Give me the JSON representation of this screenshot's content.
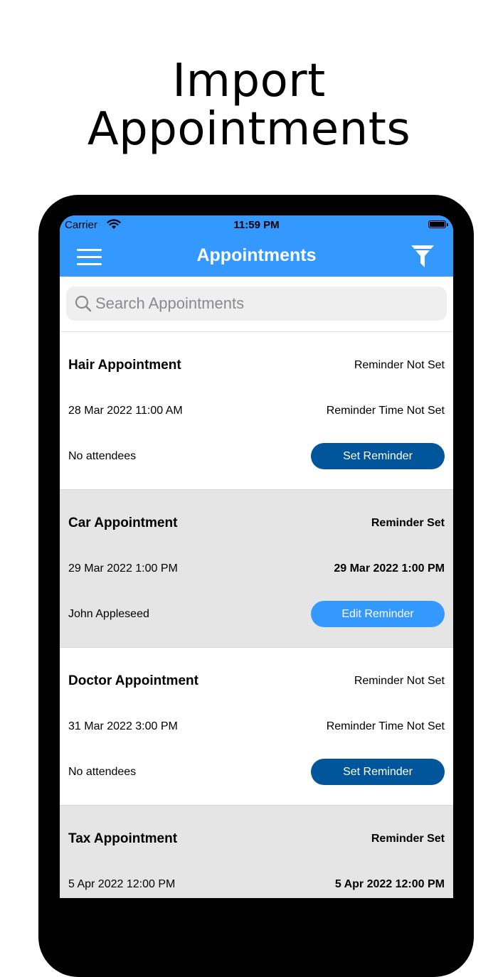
{
  "headline": {
    "line1": "Import",
    "line2": "Appointments"
  },
  "status_bar": {
    "carrier": "Carrier",
    "time": "11:59 PM",
    "wifi_icon": "wifi-icon",
    "battery_icon": "battery-icon"
  },
  "nav": {
    "title": "Appointments",
    "menu_icon": "hamburger-menu-icon",
    "filter_icon": "filter-icon"
  },
  "search": {
    "placeholder": "Search Appointments",
    "value": ""
  },
  "colors": {
    "nav_blue": "#3399ff",
    "button_dark": "#00559b",
    "button_light": "#3399ff",
    "alt_row": "#e5e5e5"
  },
  "appointments": [
    {
      "title": "Hair Appointment",
      "reminder_status": "Reminder Not Set",
      "date": "28 Mar 2022 11:00 AM",
      "reminder_time": "Reminder Time Not Set",
      "attendees": "No attendees",
      "button": "Set Reminder"
    },
    {
      "title": "Car Appointment",
      "reminder_status": "Reminder Set",
      "date": "29 Mar 2022 1:00 PM",
      "reminder_time": "29 Mar 2022 1:00 PM",
      "attendees": "John Appleseed",
      "button": "Edit Reminder"
    },
    {
      "title": "Doctor Appointment",
      "reminder_status": "Reminder Not Set",
      "date": "31 Mar 2022 3:00 PM",
      "reminder_time": "Reminder Time Not Set",
      "attendees": "No attendees",
      "button": "Set Reminder"
    },
    {
      "title": "Tax Appointment",
      "reminder_status": "Reminder Set",
      "date": "5 Apr 2022 12:00 PM",
      "reminder_time": "5 Apr 2022 12:00 PM",
      "attendees": "",
      "button": ""
    }
  ]
}
